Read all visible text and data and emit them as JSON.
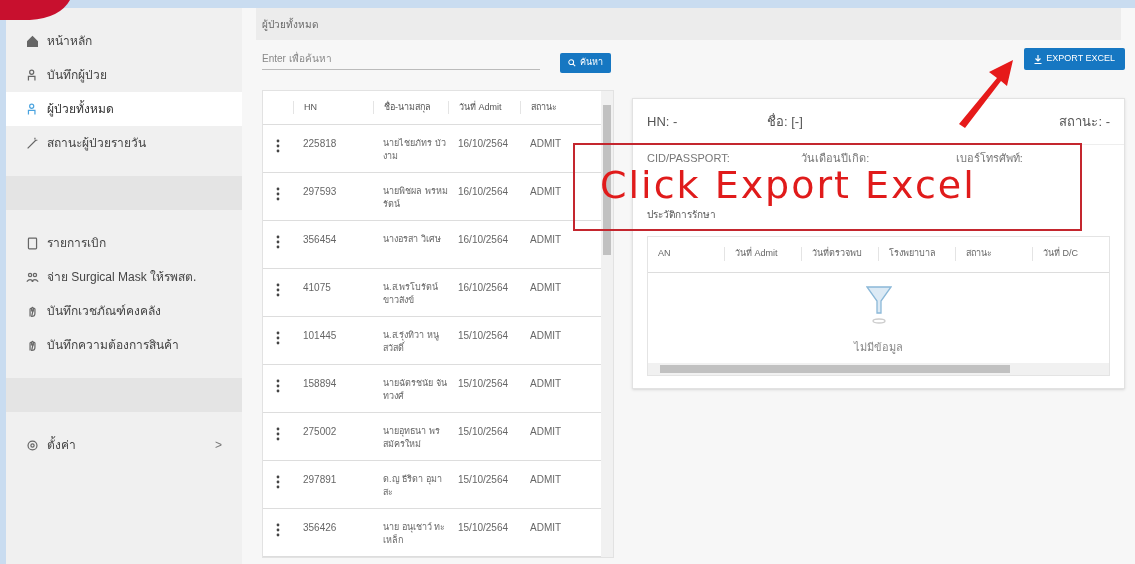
{
  "sidebar": {
    "items": [
      {
        "label": "หน้าหลัก",
        "selected": false
      },
      {
        "label": "บันทึกผู้ป่วย",
        "selected": false
      },
      {
        "label": "ผู้ป่วยทั้งหมด",
        "selected": true
      },
      {
        "label": "สถานะผู้ป่วยรายวัน",
        "selected": false
      },
      {
        "kind": "gap"
      },
      {
        "label": "รายการเบิก",
        "selected": false
      },
      {
        "label": "จ่าย Surgical Mask ให้รพสต.",
        "selected": false
      },
      {
        "label": "บันทึกเวชภัณฑ์คงคลัง",
        "selected": false
      },
      {
        "label": "บันทึกความต้องการสินค้า",
        "selected": false
      },
      {
        "kind": "gap"
      }
    ],
    "settings": {
      "label": "ตั้งค่า",
      "chevron": ">"
    }
  },
  "breadcrumb": "ผู้ป่วยทั้งหมด",
  "search": {
    "placeholder": "Enter เพื่อค้นหา",
    "button": "ค้นหา"
  },
  "export_button": "EXPORT EXCEL",
  "patients": {
    "columns": [
      "HN",
      "ชื่อ-นามสกุล",
      "วันที่ Admit",
      "สถานะ"
    ],
    "rows": [
      [
        "225818",
        "นายไชยภัทร บัวงาม",
        "16/10/2564",
        "ADMIT"
      ],
      [
        "297593",
        "นายพิชผล พรหมรัตน์",
        "16/10/2564",
        "ADMIT"
      ],
      [
        "356454",
        "นางอรสา วิเศษ",
        "16/10/2564",
        "ADMIT"
      ],
      [
        "41075",
        "น.ส.พรโบรัตน์ ขาวสังข์",
        "16/10/2564",
        "ADMIT"
      ],
      [
        "101445",
        "น.ส.รุ่งทิวา หนูสวัสดิ์",
        "15/10/2564",
        "ADMIT"
      ],
      [
        "158894",
        "นายฉัตรชนัย จันทวงศ์",
        "15/10/2564",
        "ADMIT"
      ],
      [
        "275002",
        "นายอุทธนา พร สมัครใหม่",
        "15/10/2564",
        "ADMIT"
      ],
      [
        "297891",
        "ด.ญ ธีริดา อุมาสะ",
        "15/10/2564",
        "ADMIT"
      ],
      [
        "356426",
        "นาย อนุเชาว์ ทะเหล็ก",
        "15/10/2564",
        "ADMIT"
      ]
    ]
  },
  "detail": {
    "hn": "HN: -",
    "name": "ชื่อ: [-]",
    "status": "สถานะ: -",
    "fields": [
      "CID/PASSPORT:",
      "วันเดือนปีเกิด:",
      "เบอร์โทรศัพท์:"
    ],
    "history_title": "ประวัติการรักษา",
    "history_columns": [
      "AN",
      "วันที่ Admit",
      "วันที่ตรวจพบ",
      "โรงพยาบาล",
      "สถานะ",
      "วันที่ D/C"
    ],
    "empty_text": "ไม่มีข้อมูล"
  },
  "annotation": "Click Export Excel"
}
